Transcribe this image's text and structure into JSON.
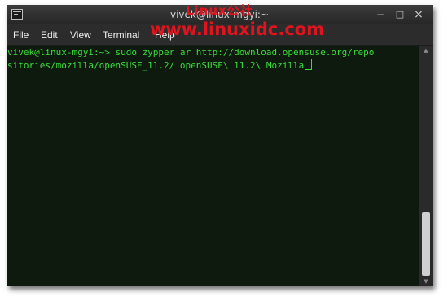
{
  "window": {
    "title": "vivek@linux-mgyi:~"
  },
  "titlebar_buttons": {
    "minimize": "−",
    "maximize": "□",
    "close": "×"
  },
  "watermark": {
    "top": "Linux公社",
    "url": "www.linuxidc.com"
  },
  "menu": {
    "file": "File",
    "edit": "Edit",
    "view": "View",
    "terminal": "Terminal",
    "help": "Help"
  },
  "terminal": {
    "lines": [
      "vivek@linux-mgyi:~> sudo zypper ar http://download.opensuse.org/repo",
      "sitories/mozilla/openSUSE_11.2/ openSUSE\\ 11.2\\ Mozilla"
    ]
  },
  "scrollbar": {
    "up_arrow": "▲",
    "down_arrow": "▼"
  },
  "colors": {
    "terminal_bg": "#0d1a0d",
    "terminal_text": "#3cdc3c",
    "watermark": "#e0141e"
  }
}
